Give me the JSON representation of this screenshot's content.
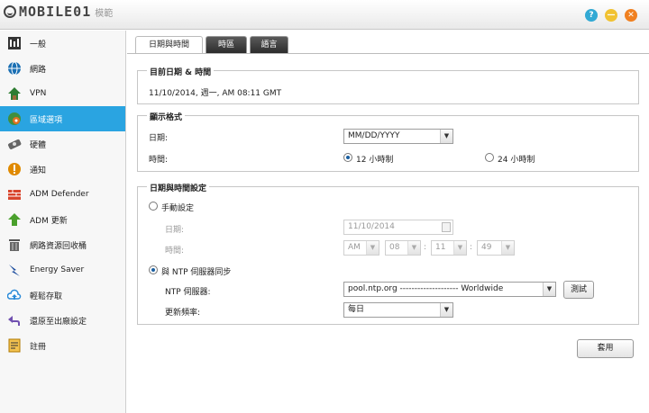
{
  "brand": {
    "logo_text": "MOBILE01",
    "subtitle": "模範"
  },
  "window": {
    "help": "?",
    "minimize": "—",
    "close": "✕"
  },
  "sidebar": {
    "items": [
      {
        "label": "一般",
        "icon": "general-icon",
        "color": "#333333"
      },
      {
        "label": "網路",
        "icon": "globe-icon",
        "color": "#1a6fb3"
      },
      {
        "label": "VPN",
        "icon": "vpn-icon",
        "color": "#2e7d32"
      },
      {
        "label": "區域選項",
        "icon": "regional-icon",
        "color": "#e07020",
        "active": true
      },
      {
        "label": "硬體",
        "icon": "hardware-icon",
        "color": "#555555"
      },
      {
        "label": "通知",
        "icon": "notification-icon",
        "color": "#e08a00"
      },
      {
        "label": "ADM Defender",
        "icon": "firewall-icon",
        "color": "#d8442c"
      },
      {
        "label": "ADM 更新",
        "icon": "update-icon",
        "color": "#4aa02c"
      },
      {
        "label": "網路資源回收桶",
        "icon": "recycle-bin-icon",
        "color": "#555555"
      },
      {
        "label": "Energy Saver",
        "icon": "energy-icon",
        "color": "#1f4f9f"
      },
      {
        "label": "輕鬆存取",
        "icon": "cloud-icon",
        "color": "#2a8ad8"
      },
      {
        "label": "還原至出廠設定",
        "icon": "restore-icon",
        "color": "#7050b0"
      },
      {
        "label": "註冊",
        "icon": "register-icon",
        "color": "#e08a00"
      }
    ]
  },
  "tabs": [
    {
      "label": "日期與時間",
      "active": true
    },
    {
      "label": "時區"
    },
    {
      "label": "語言"
    }
  ],
  "current": {
    "legend": "目前日期 & 時間",
    "value": "11/10/2014, 週一, AM 08:11 GMT"
  },
  "format": {
    "legend": "顯示格式",
    "date_label": "日期:",
    "date_value": "MM/DD/YYYY",
    "time_label": "時間:",
    "time_12": "12 小時制",
    "time_24": "24 小時制"
  },
  "settings": {
    "legend": "日期與時間設定",
    "manual_label": "手動設定",
    "date_label": "日期:",
    "date_value": "11/10/2014",
    "time_label": "時間:",
    "ampm": "AM",
    "hour": "08",
    "minute": "11",
    "second": "49",
    "ntp_sync_label": "與 NTP 伺服器同步",
    "ntp_server_label": "NTP 伺服器:",
    "ntp_server_value": "pool.ntp.org -------------------- Worldwide",
    "test_button": "測試",
    "frequency_label": "更新頻率:",
    "frequency_value": "每日"
  },
  "apply_button": "套用"
}
